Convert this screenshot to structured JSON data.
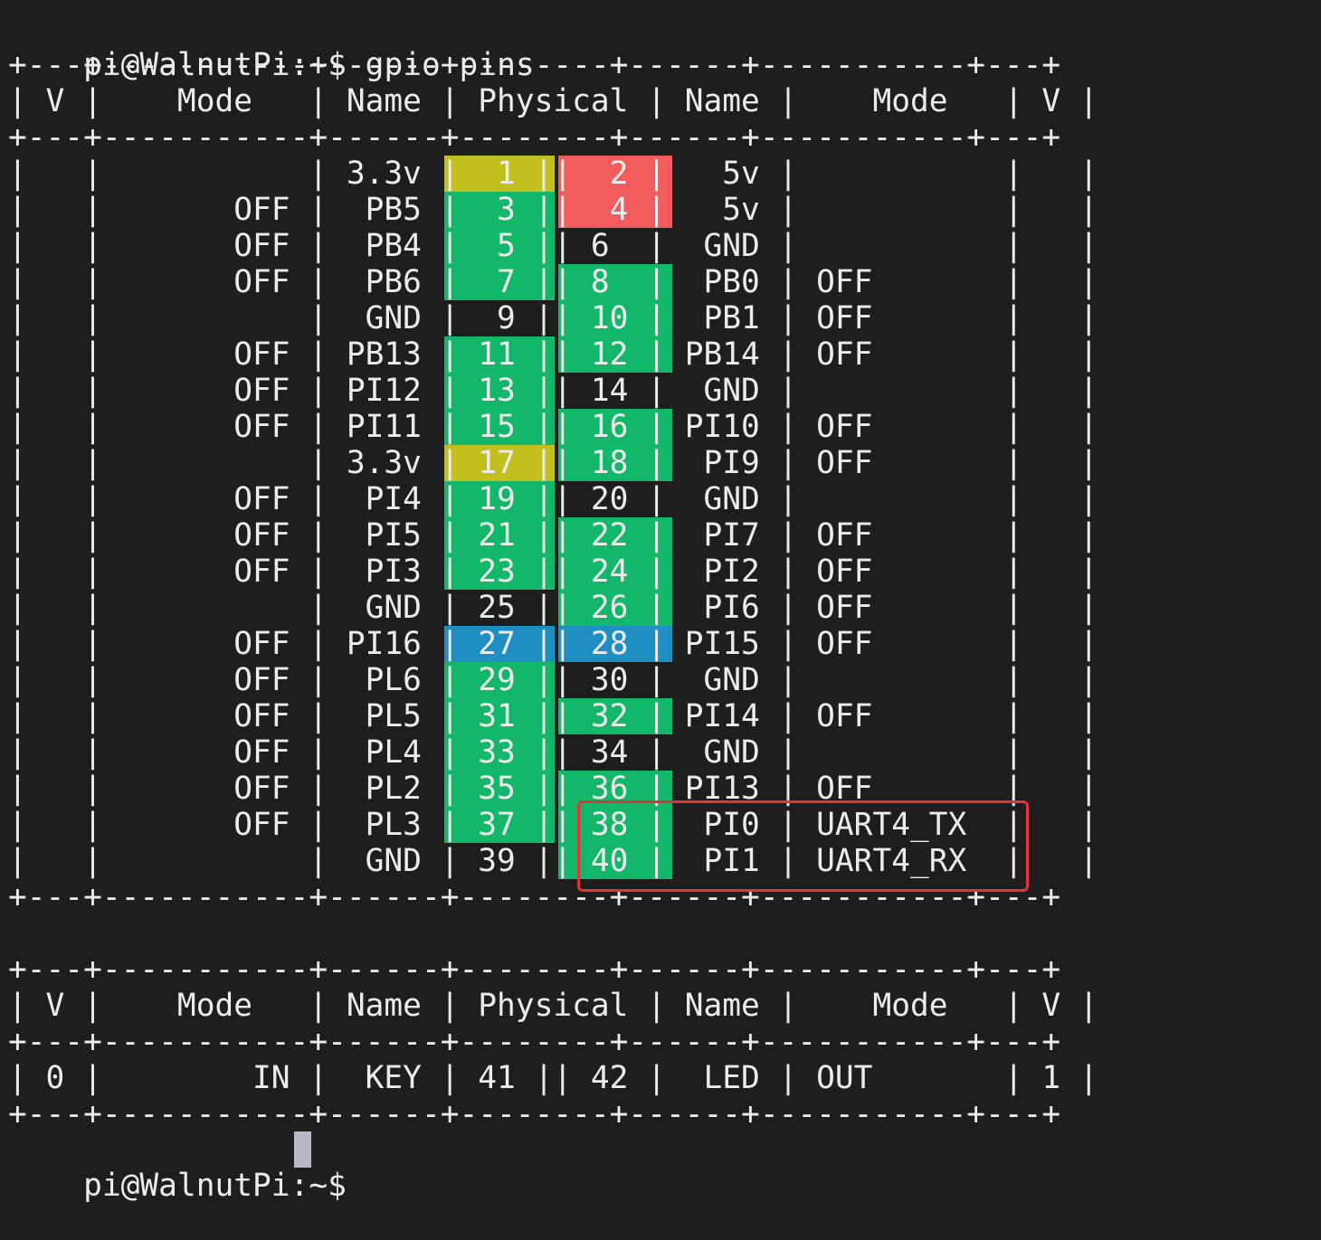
{
  "terminal": {
    "prompt": "pi@WalnutPi:~$",
    "command": "gpio pins",
    "colors": {
      "background": "#1e1e1e",
      "text": "#ececec",
      "power_3v3": "#c2c01e",
      "power_5v": "#f25c5c",
      "gpio": "#12b76a",
      "i2c": "#1e8fc0",
      "highlight_border": "#e3343a"
    },
    "table1_lines": [
      "+---+-----------+------+--------+------+-----------+---+",
      "| V |    Mode   | Name | Physical | Name |    Mode   | V |",
      "+---+-----------+------+--------+------+-----------+---+",
      "|   |           | 3.3v |  1 ||  2 |   5v |           |   |",
      "|   |       OFF |  PB5 |  3 ||  4 |   5v |           |   |",
      "|   |       OFF |  PB4 |  5 || 6  |  GND |           |   |",
      "|   |       OFF |  PB6 |  7 || 8  |  PB0 | OFF       |   |",
      "|   |           |  GND |  9 || 10 |  PB1 | OFF       |   |",
      "|   |       OFF | PB13 | 11 || 12 | PB14 | OFF       |   |",
      "|   |       OFF | PI12 | 13 || 14 |  GND |           |   |",
      "|   |       OFF | PI11 | 15 || 16 | PI10 | OFF       |   |",
      "|   |           | 3.3v | 17 || 18 |  PI9 | OFF       |   |",
      "|   |       OFF |  PI4 | 19 || 20 |  GND |           |   |",
      "|   |       OFF |  PI5 | 21 || 22 |  PI7 | OFF       |   |",
      "|   |       OFF |  PI3 | 23 || 24 |  PI2 | OFF       |   |",
      "|   |           |  GND | 25 || 26 |  PI6 | OFF       |   |",
      "|   |       OFF | PI16 | 27 || 28 | PI15 | OFF       |   |",
      "|   |       OFF |  PL6 | 29 || 30 |  GND |           |   |",
      "|   |       OFF |  PL5 | 31 || 32 | PI14 | OFF       |   |",
      "|   |       OFF |  PL4 | 33 || 34 |  GND |           |   |",
      "|   |       OFF |  PL2 | 35 || 36 | PI13 | OFF       |   |",
      "|   |       OFF |  PL3 | 37 || 38 |  PI0 | UART4_TX  |   |",
      "|   |           |  GND | 39 || 40 |  PI1 | UART4_RX  |   |",
      "+---+-----------+------+--------+------+-----------+---+"
    ],
    "table2_lines": [
      "+---+-----------+------+--------+------+-----------+---+",
      "| V |    Mode   | Name | Physical | Name |    Mode   | V |",
      "+---+-----------+------+--------+------+-----------+---+",
      "| 0 |        IN |  KEY | 41 || 42 |  LED | OUT       | 1 |",
      "+---+-----------+------+--------+------+-----------+---+"
    ],
    "final_prompt": "pi@WalnutPi:~$"
  }
}
